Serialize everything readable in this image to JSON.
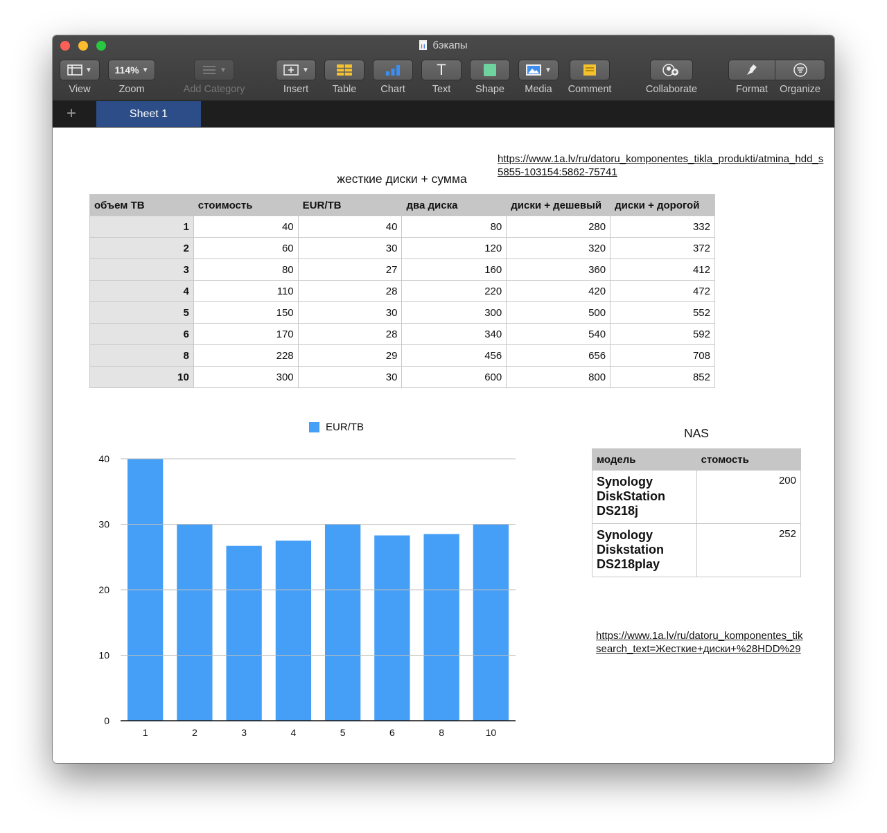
{
  "window": {
    "title": "бэкапы"
  },
  "toolbar": {
    "view": {
      "label": "View",
      "icon": "sidebar-view-icon"
    },
    "zoom": {
      "label": "Zoom",
      "value": "114%"
    },
    "add_category": {
      "label": "Add Category",
      "icon": "list-icon"
    },
    "insert": {
      "label": "Insert",
      "icon": "insert-icon"
    },
    "table": {
      "label": "Table",
      "icon": "table-icon",
      "color": "#f5c22d"
    },
    "chart": {
      "label": "Chart",
      "icon": "chart-icon",
      "color": "#3d8ef0"
    },
    "text": {
      "label": "Text",
      "icon": "text-icon",
      "glyph": "T"
    },
    "shape": {
      "label": "Shape",
      "icon": "shape-icon",
      "color": "#6fd3a0"
    },
    "media": {
      "label": "Media",
      "icon": "media-icon",
      "color": "#3d8ef0"
    },
    "comment": {
      "label": "Comment",
      "icon": "comment-icon",
      "color": "#f5c22d"
    },
    "collaborate": {
      "label": "Collaborate",
      "icon": "collaborate-icon"
    },
    "format": {
      "label": "Format",
      "icon": "format-brush-icon"
    },
    "organize": {
      "label": "Organize",
      "icon": "organize-icon"
    }
  },
  "tabs": {
    "add_label": "+",
    "active": "Sheet 1"
  },
  "links": {
    "top_line1": "https://www.1a.lv/ru/datoru_komponentes_tikla_produkti/atmina_hdd_s",
    "top_line2": "5855-103154:5862-75741",
    "bottom_line1": "https://www.1a.lv/ru/datoru_komponentes_tik",
    "bottom_line2": "search_text=Жесткие+диски+%28HDD%29"
  },
  "disks_table": {
    "title": "жесткие диски + сумма",
    "headers": [
      "объем ТВ",
      "стоимость",
      "EUR/TB",
      "два диска",
      "диски + дешевый",
      "диски + дорогой"
    ],
    "rows": [
      [
        "1",
        "40",
        "40",
        "80",
        "280",
        "332"
      ],
      [
        "2",
        "60",
        "30",
        "120",
        "320",
        "372"
      ],
      [
        "3",
        "80",
        "27",
        "160",
        "360",
        "412"
      ],
      [
        "4",
        "110",
        "28",
        "220",
        "420",
        "472"
      ],
      [
        "5",
        "150",
        "30",
        "300",
        "500",
        "552"
      ],
      [
        "6",
        "170",
        "28",
        "340",
        "540",
        "592"
      ],
      [
        "8",
        "228",
        "29",
        "456",
        "656",
        "708"
      ],
      [
        "10",
        "300",
        "30",
        "600",
        "800",
        "852"
      ]
    ]
  },
  "nas_table": {
    "title": "NAS",
    "headers": [
      "модель",
      "стомость"
    ],
    "rows": [
      [
        "Synology DiskStation DS218j",
        "200"
      ],
      [
        "Synology Diskstation DS218play",
        "252"
      ]
    ]
  },
  "chart_data": {
    "type": "bar",
    "categories": [
      "1",
      "2",
      "3",
      "4",
      "5",
      "6",
      "8",
      "10"
    ],
    "series": [
      {
        "name": "EUR/TB",
        "values": [
          40,
          30,
          26.7,
          27.5,
          30,
          28.3,
          28.5,
          30
        ],
        "color": "#459ff6"
      }
    ],
    "title": "",
    "xlabel": "",
    "ylabel": "",
    "ylim": [
      0,
      40
    ],
    "yticks": [
      "0",
      "10",
      "20",
      "30",
      "40"
    ],
    "grid": true,
    "legend": "top-center"
  }
}
